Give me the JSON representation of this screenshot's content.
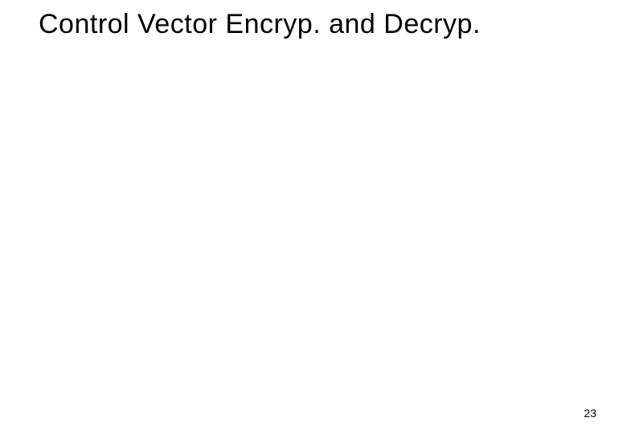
{
  "slide": {
    "title": "Control Vector Encryp. and Decryp.",
    "page_number": "23"
  }
}
